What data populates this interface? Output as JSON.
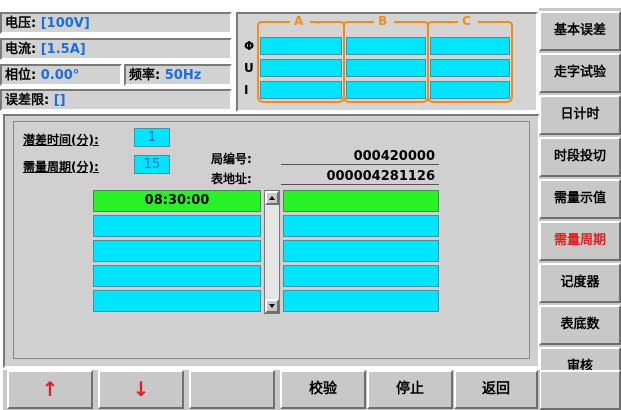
{
  "info": {
    "voltage_label": "电压:",
    "voltage_value": "[100V]",
    "current_label": "电流:",
    "current_value": "[1.5A]",
    "phase_label": "相位:",
    "phase_value": "0.00°",
    "freq_label": "频率:",
    "freq_value": "50Hz",
    "error_limit_label": "误差限:",
    "error_limit_value": "[]"
  },
  "vector_table": {
    "col_a": "A",
    "col_b": "B",
    "col_c": "C",
    "row_phi": "Φ",
    "row_u": "U",
    "row_i": "I"
  },
  "main": {
    "creep_time_label": "潜差时间(分):",
    "creep_time_value": "1",
    "demand_period_label": "需量周期(分):",
    "demand_period_value": "15",
    "bureau_no_label": "局编号:",
    "bureau_no_value": "000420000",
    "meter_addr_label": "表地址:",
    "meter_addr_value": "000004281126",
    "list_left": [
      "08:30:00",
      "",
      "",
      "",
      ""
    ],
    "list_right": [
      "",
      "",
      "",
      "",
      ""
    ]
  },
  "sidebar": {
    "items": [
      {
        "label": "基本误差"
      },
      {
        "label": "走字试验"
      },
      {
        "label": "日计时"
      },
      {
        "label": "时段投切"
      },
      {
        "label": "需量示值"
      },
      {
        "label": "需量周期"
      },
      {
        "label": "记度器"
      },
      {
        "label": "表底数"
      },
      {
        "label": "审核"
      }
    ],
    "active_index": 5
  },
  "bottom_bar": {
    "up_label": "↑",
    "down_label": "↓",
    "blank_label": "",
    "verify_label": "校验",
    "stop_label": "停止",
    "back_label": "返回"
  },
  "colors": {
    "cyan": "#00e5ff",
    "green": "#26f226",
    "value_blue": "#1a6fd8",
    "active_red": "#e02020",
    "arrow_red": "#e02020",
    "orange": "#f08c1e"
  }
}
